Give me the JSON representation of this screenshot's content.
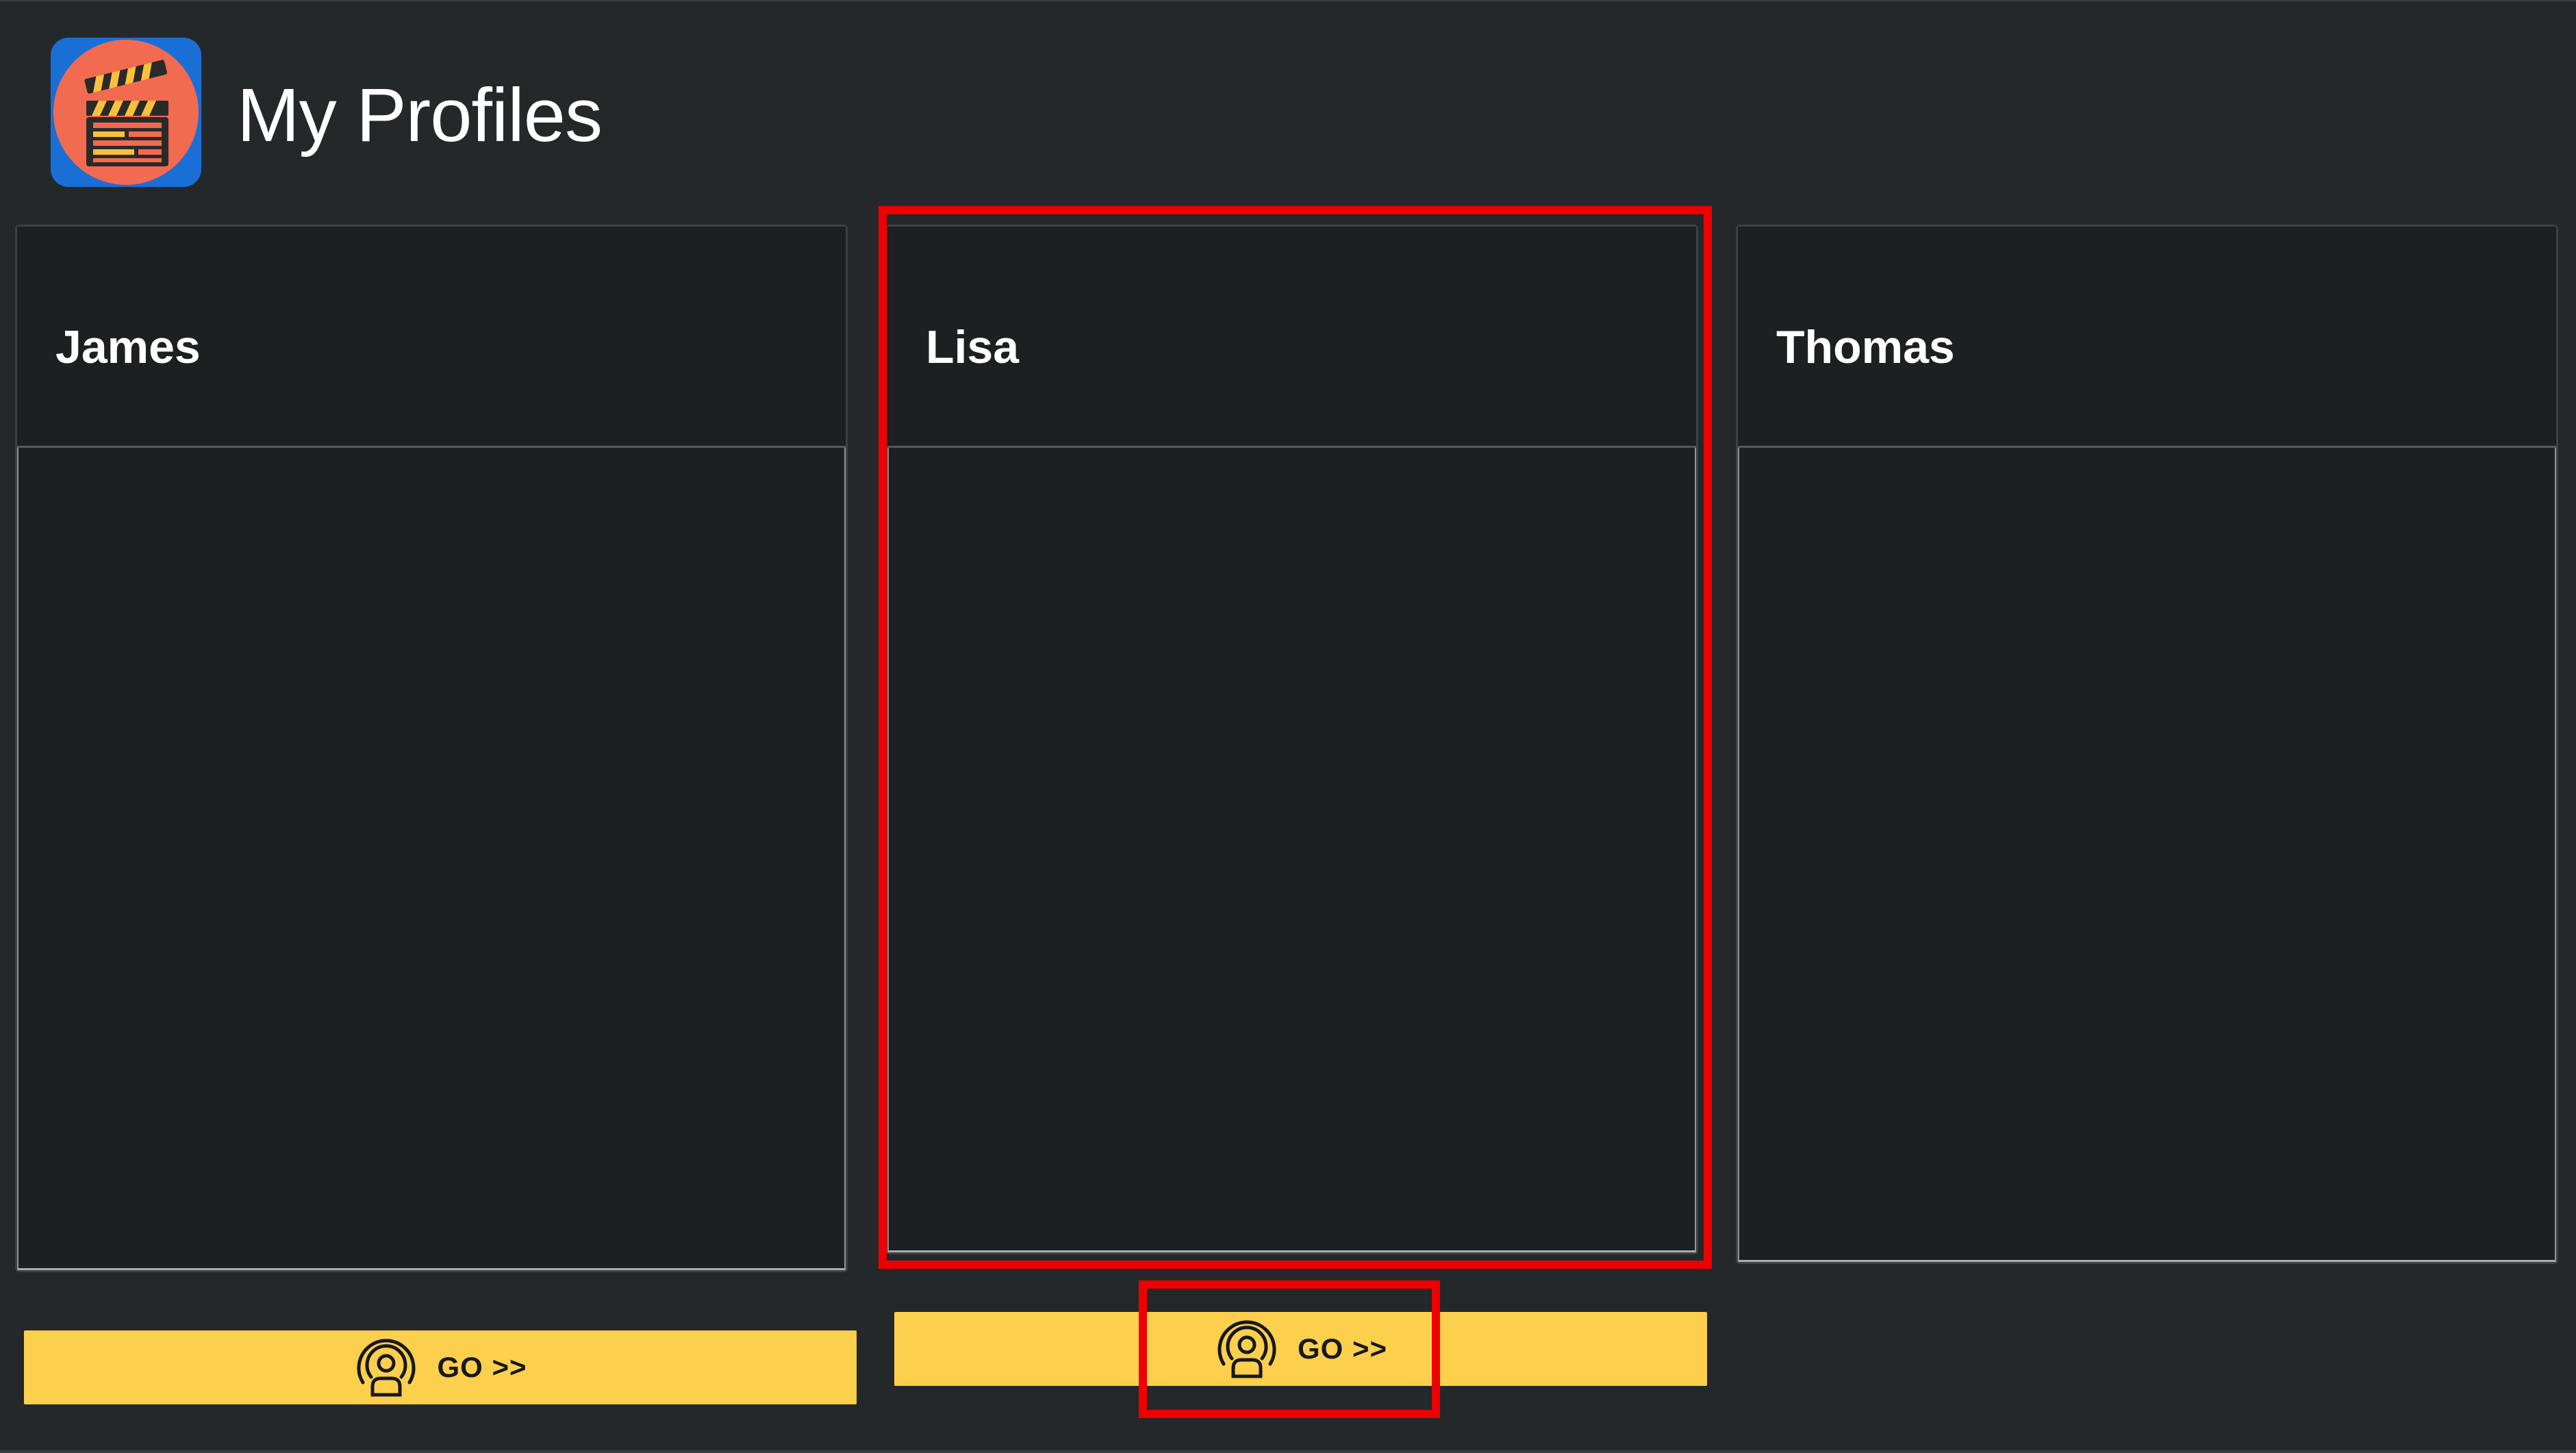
{
  "header": {
    "title": "My Profiles",
    "app_icon": "clapperboard-icon"
  },
  "profiles": [
    {
      "name": "James",
      "button_label": "GO >>",
      "button_icon": "person-broadcast-icon"
    },
    {
      "name": "Lisa",
      "button_label": "GO >>",
      "button_icon": "person-broadcast-icon"
    },
    {
      "name": "Thomas"
    }
  ],
  "highlights": [
    "Lisa profile card",
    "Lisa GO button"
  ],
  "colors": {
    "background": "#25282b",
    "card": "#1e1f21",
    "button": "#fccf4d",
    "highlight": "#ee0000",
    "icon_bg": "#1a6fd6",
    "icon_circle": "#f26a4f"
  }
}
